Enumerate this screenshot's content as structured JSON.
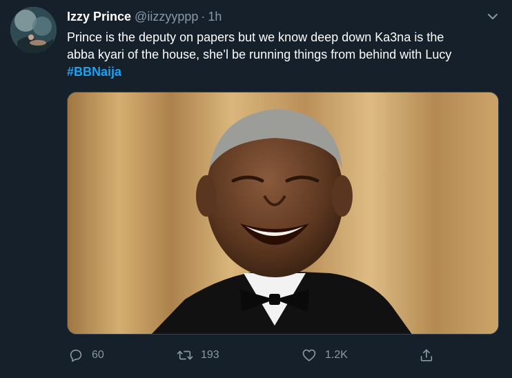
{
  "tweet": {
    "author": {
      "name": "Izzy Prince",
      "handle": "@iizzyyppp",
      "separator": "·",
      "time": "1h"
    },
    "text": "Prince is the deputy on papers but we know deep down Ka3na is the\nabba kyari of the house, she’l be running things from behind with Lucy\n",
    "hashtag": "#BBNaija",
    "actions": {
      "reply": {
        "icon": "reply-icon",
        "count": "60"
      },
      "retweet": {
        "icon": "retweet-icon",
        "count": "193"
      },
      "like": {
        "icon": "heart-icon",
        "count": "1.2K"
      },
      "share": {
        "icon": "share-icon"
      }
    }
  },
  "colors": {
    "background": "#15202b",
    "secondary_text": "#8899a6",
    "link": "#1da1f2",
    "border": "#38444d"
  }
}
